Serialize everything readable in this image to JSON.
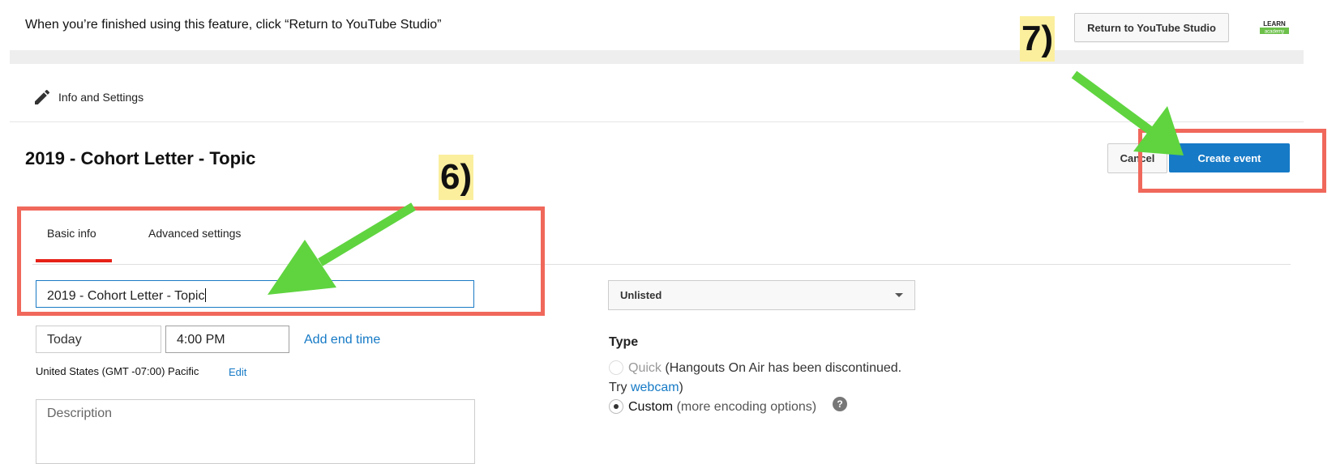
{
  "top_bar": {
    "notice": "When you’re finished using this feature, click “Return to YouTube Studio”",
    "return_button": "Return to YouTube Studio",
    "logo_text_top": "LEARN",
    "logo_text_bottom": "academy"
  },
  "section": {
    "title": "Info and Settings",
    "icon": "pencil-icon"
  },
  "event": {
    "title": "2019 - Cohort Letter - Topic",
    "cancel_button": "Cancel",
    "create_button": "Create event"
  },
  "tabs": [
    {
      "label": "Basic info",
      "active": true
    },
    {
      "label": "Advanced settings",
      "active": false
    }
  ],
  "form": {
    "title_value": "2019 - Cohort Letter - Topic",
    "date_value": "Today",
    "time_value": "4:00 PM",
    "add_end_time": "Add end time",
    "timezone": "United States (GMT -07:00) Pacific",
    "timezone_edit": "Edit",
    "description_placeholder": "Description",
    "privacy_value": "Unlisted",
    "type_label": "Type",
    "quick_label": "Quick",
    "quick_note": "(Hangouts On Air has been discontinued.",
    "try_text": "Try",
    "webcam_link": "webcam",
    "try_close": ")",
    "custom_label": "Custom",
    "custom_note": "(more encoding options)",
    "help": "?"
  },
  "annotations": {
    "step6": "6)",
    "step7": "7)",
    "box_color": "#f0685b",
    "arrow_color": "#5fd43f",
    "label_bg": "#fbef9e"
  },
  "colors": {
    "accent": "#167ac6",
    "tab_underline": "#e62117"
  }
}
